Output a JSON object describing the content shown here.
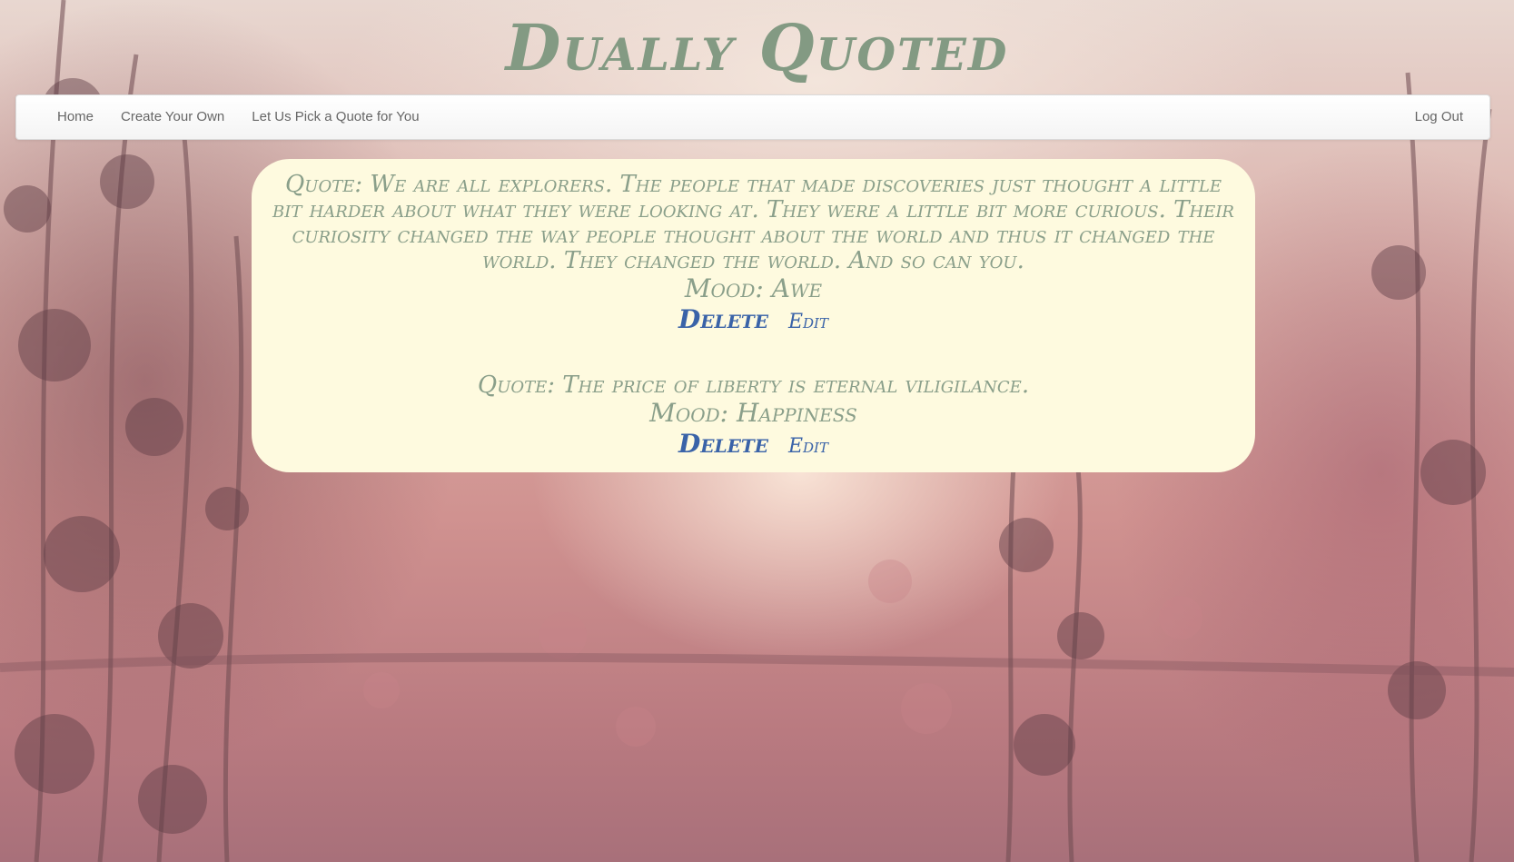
{
  "site": {
    "title": "Dually Quoted"
  },
  "nav": {
    "left_items": [
      {
        "label": "Home"
      },
      {
        "label": "Create Your Own"
      },
      {
        "label": "Let Us Pick a Quote for You"
      }
    ],
    "right_item": {
      "label": "Log Out"
    }
  },
  "quotes": [
    {
      "text": "Quote: We are all explorers. The people that made discoveries just thought a little bit harder about what they were looking at. They were a little bit more curious. Their curiosity changed the way people thought about the world and thus it changed the world. They changed the world. And so can you.",
      "mood": "Mood: Awe",
      "delete_label": "Delete",
      "edit_label": "Edit"
    },
    {
      "text": "Quote: The price of liberty is eternal viligilance.",
      "mood": "Mood: Happiness",
      "delete_label": "Delete",
      "edit_label": "Edit"
    }
  ],
  "colors": {
    "title": "#839a83",
    "quote_text": "#8a9f8a",
    "link": "#3a63a8",
    "panel": "#fefadf",
    "nav_text": "#666666"
  }
}
